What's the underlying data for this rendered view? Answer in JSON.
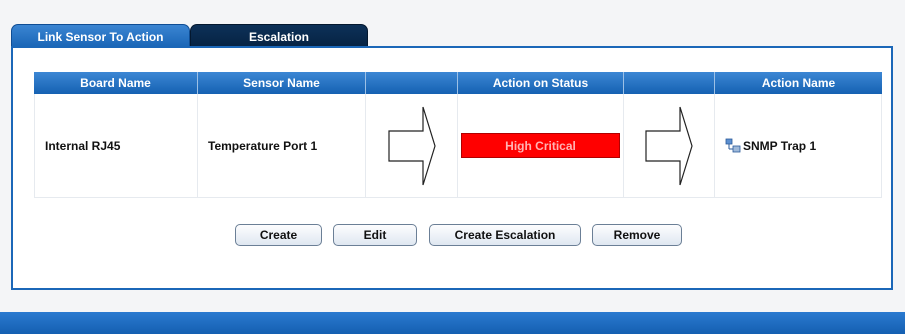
{
  "tabs": [
    {
      "label": "Link Sensor To Action",
      "active": true
    },
    {
      "label": "Escalation",
      "active": false
    }
  ],
  "table": {
    "headers": [
      "Board Name",
      "Sensor Name",
      "",
      "Action on Status",
      "",
      "Action Name"
    ],
    "row": {
      "board_name": "Internal RJ45",
      "sensor_name": "Temperature Port 1",
      "status": "High Critical",
      "action_name": "SNMP Trap 1",
      "action_icon": "network-icon"
    }
  },
  "buttons": {
    "create": "Create",
    "edit": "Edit",
    "create_escalation": "Create Escalation",
    "remove": "Remove"
  },
  "colors": {
    "accent": "#1b67b8",
    "status_critical": "#ff0000",
    "tab_inactive": "#0a2a4d"
  }
}
